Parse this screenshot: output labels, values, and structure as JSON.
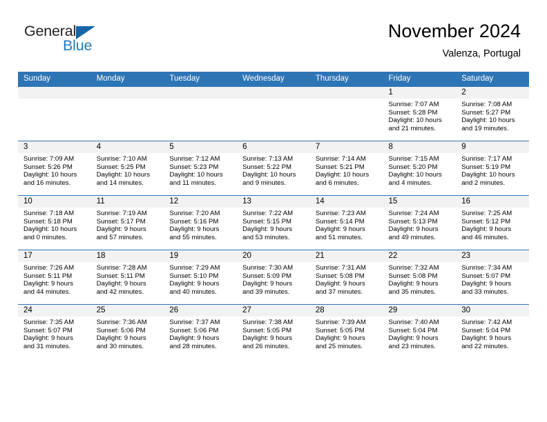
{
  "brand": {
    "name_part1": "General",
    "name_part2": "Blue",
    "logo_icon": "blue-triangle-mark"
  },
  "header": {
    "title": "November 2024",
    "location": "Valenza, Portugal"
  },
  "colors": {
    "header_blue": "#2e75b6",
    "daynum_band": "#f2f2f2",
    "brand_blue": "#1f7ac0"
  },
  "weekday_headers": [
    "Sunday",
    "Monday",
    "Tuesday",
    "Wednesday",
    "Thursday",
    "Friday",
    "Saturday"
  ],
  "weeks": [
    [
      {
        "day": "",
        "sunrise": "",
        "sunset": "",
        "daylight_line1": "",
        "daylight_line2": ""
      },
      {
        "day": "",
        "sunrise": "",
        "sunset": "",
        "daylight_line1": "",
        "daylight_line2": ""
      },
      {
        "day": "",
        "sunrise": "",
        "sunset": "",
        "daylight_line1": "",
        "daylight_line2": ""
      },
      {
        "day": "",
        "sunrise": "",
        "sunset": "",
        "daylight_line1": "",
        "daylight_line2": ""
      },
      {
        "day": "",
        "sunrise": "",
        "sunset": "",
        "daylight_line1": "",
        "daylight_line2": ""
      },
      {
        "day": "1",
        "sunrise": "Sunrise: 7:07 AM",
        "sunset": "Sunset: 5:28 PM",
        "daylight_line1": "Daylight: 10 hours",
        "daylight_line2": "and 21 minutes."
      },
      {
        "day": "2",
        "sunrise": "Sunrise: 7:08 AM",
        "sunset": "Sunset: 5:27 PM",
        "daylight_line1": "Daylight: 10 hours",
        "daylight_line2": "and 19 minutes."
      }
    ],
    [
      {
        "day": "3",
        "sunrise": "Sunrise: 7:09 AM",
        "sunset": "Sunset: 5:26 PM",
        "daylight_line1": "Daylight: 10 hours",
        "daylight_line2": "and 16 minutes."
      },
      {
        "day": "4",
        "sunrise": "Sunrise: 7:10 AM",
        "sunset": "Sunset: 5:25 PM",
        "daylight_line1": "Daylight: 10 hours",
        "daylight_line2": "and 14 minutes."
      },
      {
        "day": "5",
        "sunrise": "Sunrise: 7:12 AM",
        "sunset": "Sunset: 5:23 PM",
        "daylight_line1": "Daylight: 10 hours",
        "daylight_line2": "and 11 minutes."
      },
      {
        "day": "6",
        "sunrise": "Sunrise: 7:13 AM",
        "sunset": "Sunset: 5:22 PM",
        "daylight_line1": "Daylight: 10 hours",
        "daylight_line2": "and 9 minutes."
      },
      {
        "day": "7",
        "sunrise": "Sunrise: 7:14 AM",
        "sunset": "Sunset: 5:21 PM",
        "daylight_line1": "Daylight: 10 hours",
        "daylight_line2": "and 6 minutes."
      },
      {
        "day": "8",
        "sunrise": "Sunrise: 7:15 AM",
        "sunset": "Sunset: 5:20 PM",
        "daylight_line1": "Daylight: 10 hours",
        "daylight_line2": "and 4 minutes."
      },
      {
        "day": "9",
        "sunrise": "Sunrise: 7:17 AM",
        "sunset": "Sunset: 5:19 PM",
        "daylight_line1": "Daylight: 10 hours",
        "daylight_line2": "and 2 minutes."
      }
    ],
    [
      {
        "day": "10",
        "sunrise": "Sunrise: 7:18 AM",
        "sunset": "Sunset: 5:18 PM",
        "daylight_line1": "Daylight: 10 hours",
        "daylight_line2": "and 0 minutes."
      },
      {
        "day": "11",
        "sunrise": "Sunrise: 7:19 AM",
        "sunset": "Sunset: 5:17 PM",
        "daylight_line1": "Daylight: 9 hours",
        "daylight_line2": "and 57 minutes."
      },
      {
        "day": "12",
        "sunrise": "Sunrise: 7:20 AM",
        "sunset": "Sunset: 5:16 PM",
        "daylight_line1": "Daylight: 9 hours",
        "daylight_line2": "and 55 minutes."
      },
      {
        "day": "13",
        "sunrise": "Sunrise: 7:22 AM",
        "sunset": "Sunset: 5:15 PM",
        "daylight_line1": "Daylight: 9 hours",
        "daylight_line2": "and 53 minutes."
      },
      {
        "day": "14",
        "sunrise": "Sunrise: 7:23 AM",
        "sunset": "Sunset: 5:14 PM",
        "daylight_line1": "Daylight: 9 hours",
        "daylight_line2": "and 51 minutes."
      },
      {
        "day": "15",
        "sunrise": "Sunrise: 7:24 AM",
        "sunset": "Sunset: 5:13 PM",
        "daylight_line1": "Daylight: 9 hours",
        "daylight_line2": "and 49 minutes."
      },
      {
        "day": "16",
        "sunrise": "Sunrise: 7:25 AM",
        "sunset": "Sunset: 5:12 PM",
        "daylight_line1": "Daylight: 9 hours",
        "daylight_line2": "and 46 minutes."
      }
    ],
    [
      {
        "day": "17",
        "sunrise": "Sunrise: 7:26 AM",
        "sunset": "Sunset: 5:11 PM",
        "daylight_line1": "Daylight: 9 hours",
        "daylight_line2": "and 44 minutes."
      },
      {
        "day": "18",
        "sunrise": "Sunrise: 7:28 AM",
        "sunset": "Sunset: 5:11 PM",
        "daylight_line1": "Daylight: 9 hours",
        "daylight_line2": "and 42 minutes."
      },
      {
        "day": "19",
        "sunrise": "Sunrise: 7:29 AM",
        "sunset": "Sunset: 5:10 PM",
        "daylight_line1": "Daylight: 9 hours",
        "daylight_line2": "and 40 minutes."
      },
      {
        "day": "20",
        "sunrise": "Sunrise: 7:30 AM",
        "sunset": "Sunset: 5:09 PM",
        "daylight_line1": "Daylight: 9 hours",
        "daylight_line2": "and 39 minutes."
      },
      {
        "day": "21",
        "sunrise": "Sunrise: 7:31 AM",
        "sunset": "Sunset: 5:08 PM",
        "daylight_line1": "Daylight: 9 hours",
        "daylight_line2": "and 37 minutes."
      },
      {
        "day": "22",
        "sunrise": "Sunrise: 7:32 AM",
        "sunset": "Sunset: 5:08 PM",
        "daylight_line1": "Daylight: 9 hours",
        "daylight_line2": "and 35 minutes."
      },
      {
        "day": "23",
        "sunrise": "Sunrise: 7:34 AM",
        "sunset": "Sunset: 5:07 PM",
        "daylight_line1": "Daylight: 9 hours",
        "daylight_line2": "and 33 minutes."
      }
    ],
    [
      {
        "day": "24",
        "sunrise": "Sunrise: 7:35 AM",
        "sunset": "Sunset: 5:07 PM",
        "daylight_line1": "Daylight: 9 hours",
        "daylight_line2": "and 31 minutes."
      },
      {
        "day": "25",
        "sunrise": "Sunrise: 7:36 AM",
        "sunset": "Sunset: 5:06 PM",
        "daylight_line1": "Daylight: 9 hours",
        "daylight_line2": "and 30 minutes."
      },
      {
        "day": "26",
        "sunrise": "Sunrise: 7:37 AM",
        "sunset": "Sunset: 5:06 PM",
        "daylight_line1": "Daylight: 9 hours",
        "daylight_line2": "and 28 minutes."
      },
      {
        "day": "27",
        "sunrise": "Sunrise: 7:38 AM",
        "sunset": "Sunset: 5:05 PM",
        "daylight_line1": "Daylight: 9 hours",
        "daylight_line2": "and 26 minutes."
      },
      {
        "day": "28",
        "sunrise": "Sunrise: 7:39 AM",
        "sunset": "Sunset: 5:05 PM",
        "daylight_line1": "Daylight: 9 hours",
        "daylight_line2": "and 25 minutes."
      },
      {
        "day": "29",
        "sunrise": "Sunrise: 7:40 AM",
        "sunset": "Sunset: 5:04 PM",
        "daylight_line1": "Daylight: 9 hours",
        "daylight_line2": "and 23 minutes."
      },
      {
        "day": "30",
        "sunrise": "Sunrise: 7:42 AM",
        "sunset": "Sunset: 5:04 PM",
        "daylight_line1": "Daylight: 9 hours",
        "daylight_line2": "and 22 minutes."
      }
    ]
  ]
}
